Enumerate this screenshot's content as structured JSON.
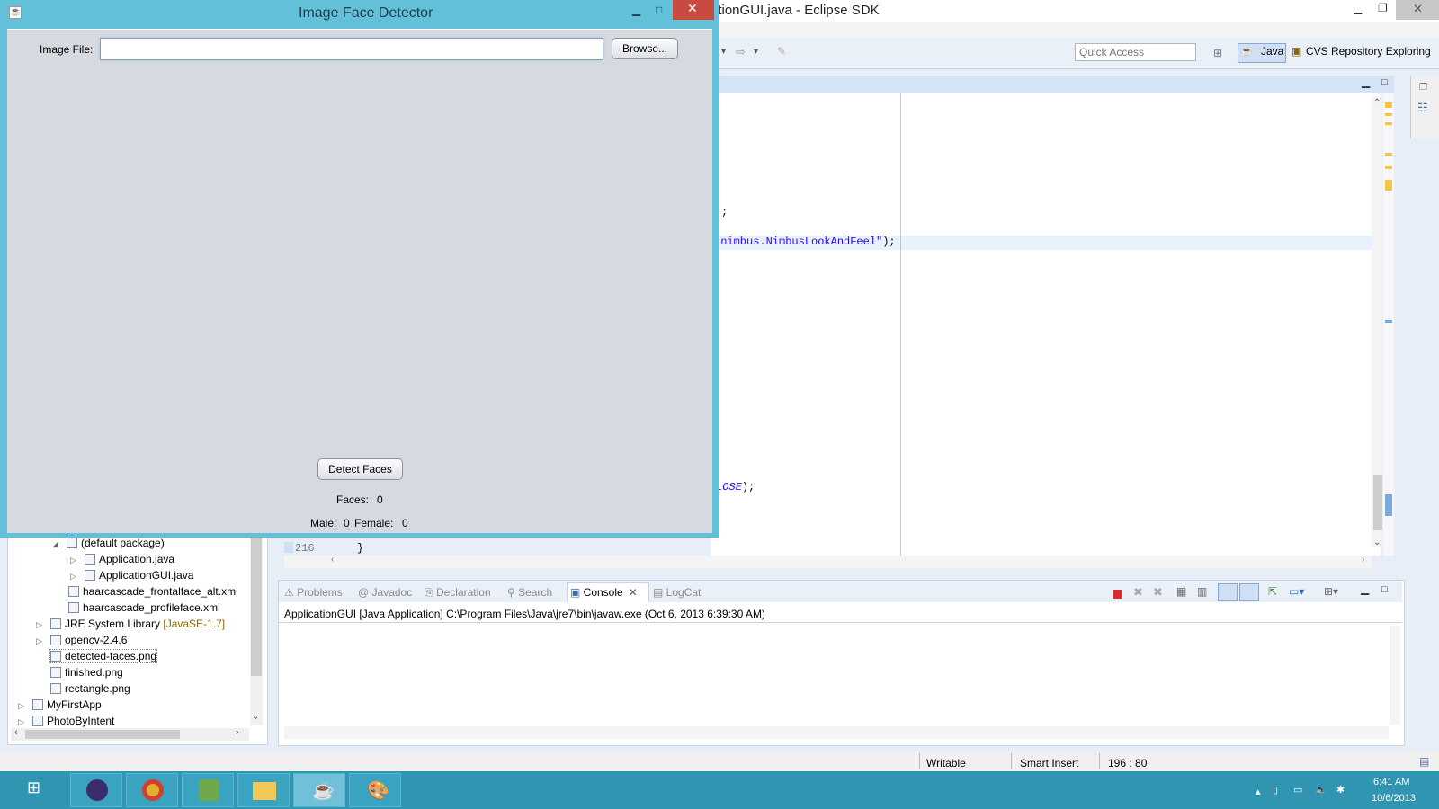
{
  "eclipse": {
    "title": "ationGUI.java - Eclipse SDK",
    "quick_access_placeholder": "Quick Access",
    "perspectives": [
      {
        "label": "Java"
      },
      {
        "label": "CVS Repository Exploring"
      }
    ],
    "editor": {
      "lines": [
        {
          "text": ";"
        },
        {
          "text_prefix": ".nimbus.NimbusLookAndFeel\"",
          "text_suffix": ");"
        },
        {
          "text_prefix": "LOSE",
          "text_suffix": ");"
        }
      ],
      "line_number": "216",
      "line_brace": "}"
    },
    "package_explorer": {
      "items": [
        {
          "label": "(default package)"
        },
        {
          "label": "Application.java"
        },
        {
          "label": "ApplicationGUI.java"
        },
        {
          "label": "haarcascade_frontalface_alt.xml"
        },
        {
          "label": "haarcascade_profileface.xml"
        },
        {
          "label": "JRE System Library",
          "suffix": "[JavaSE-1.7]"
        },
        {
          "label": "opencv-2.4.6"
        },
        {
          "label": "detected-faces.png"
        },
        {
          "label": "finished.png"
        },
        {
          "label": "rectangle.png"
        },
        {
          "label": "MyFirstApp"
        },
        {
          "label": "PhotoByIntent"
        }
      ]
    },
    "console": {
      "tabs": [
        {
          "label": "Problems"
        },
        {
          "label": "Javadoc"
        },
        {
          "label": "Declaration"
        },
        {
          "label": "Search"
        },
        {
          "label": "Console"
        },
        {
          "label": "LogCat"
        }
      ],
      "header": "ApplicationGUI [Java Application] C:\\Program Files\\Java\\jre7\\bin\\javaw.exe (Oct 6, 2013 6:39:30 AM)"
    },
    "status": {
      "writable": "Writable",
      "insert_mode": "Smart Insert",
      "position": "196 : 80"
    }
  },
  "dialog": {
    "title": "Image Face Detector",
    "image_file_label": "Image File:",
    "image_file_value": "",
    "browse_label": "Browse...",
    "detect_label": "Detect Faces",
    "faces_label": "Faces:",
    "faces_value": "0",
    "male_label": "Male:",
    "male_value": "0",
    "female_label": "Female:",
    "female_value": "0"
  },
  "taskbar": {
    "time": "6:41 AM",
    "date": "10/6/2013"
  },
  "colors": {
    "dialog_frame": "#62c0d8",
    "dialog_body": "#d6d9df",
    "taskbar": "#2f95b1",
    "close_button": "#c94a3e"
  }
}
